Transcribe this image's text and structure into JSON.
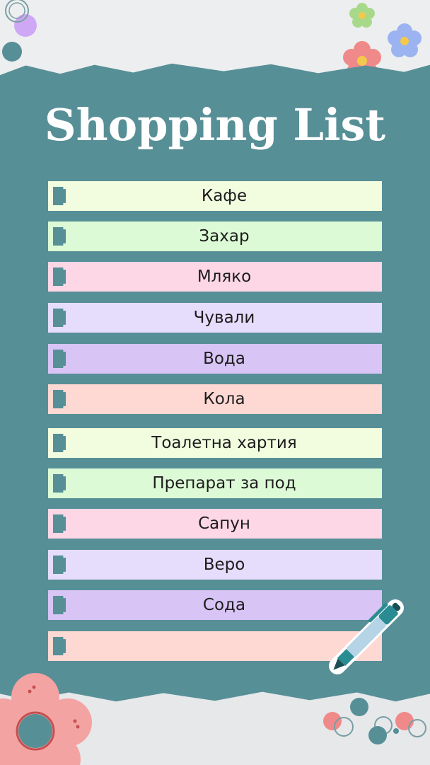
{
  "title": "Shopping List",
  "colors": {
    "board": "#578f97",
    "row_colors": [
      "#f2fde0",
      "#ddfad6",
      "#fdd7e6",
      "#e6dcfc",
      "#d8c4f5",
      "#fed8d3"
    ]
  },
  "items": [
    {
      "label": "Кафе",
      "color": "#f2fde0"
    },
    {
      "label": "Захар",
      "color": "#ddfad6"
    },
    {
      "label": "Мляко",
      "color": "#fdd7e6"
    },
    {
      "label": "Чували",
      "color": "#e6dcfc"
    },
    {
      "label": "Вода",
      "color": "#d8c4f5"
    },
    {
      "label": "Кола",
      "color": "#fed8d3"
    },
    {
      "label": "Тоалетна хартия",
      "color": "#f2fde0"
    },
    {
      "label": "Препарат за под",
      "color": "#ddfad6"
    },
    {
      "label": "Сапун",
      "color": "#fdd7e6"
    },
    {
      "label": "Веро",
      "color": "#e6dcfc"
    },
    {
      "label": "Сода",
      "color": "#d8c4f5"
    },
    {
      "label": "",
      "color": "#fed8d3"
    }
  ],
  "icons": [
    "flower-icon",
    "pen-icon",
    "circle-icon"
  ]
}
